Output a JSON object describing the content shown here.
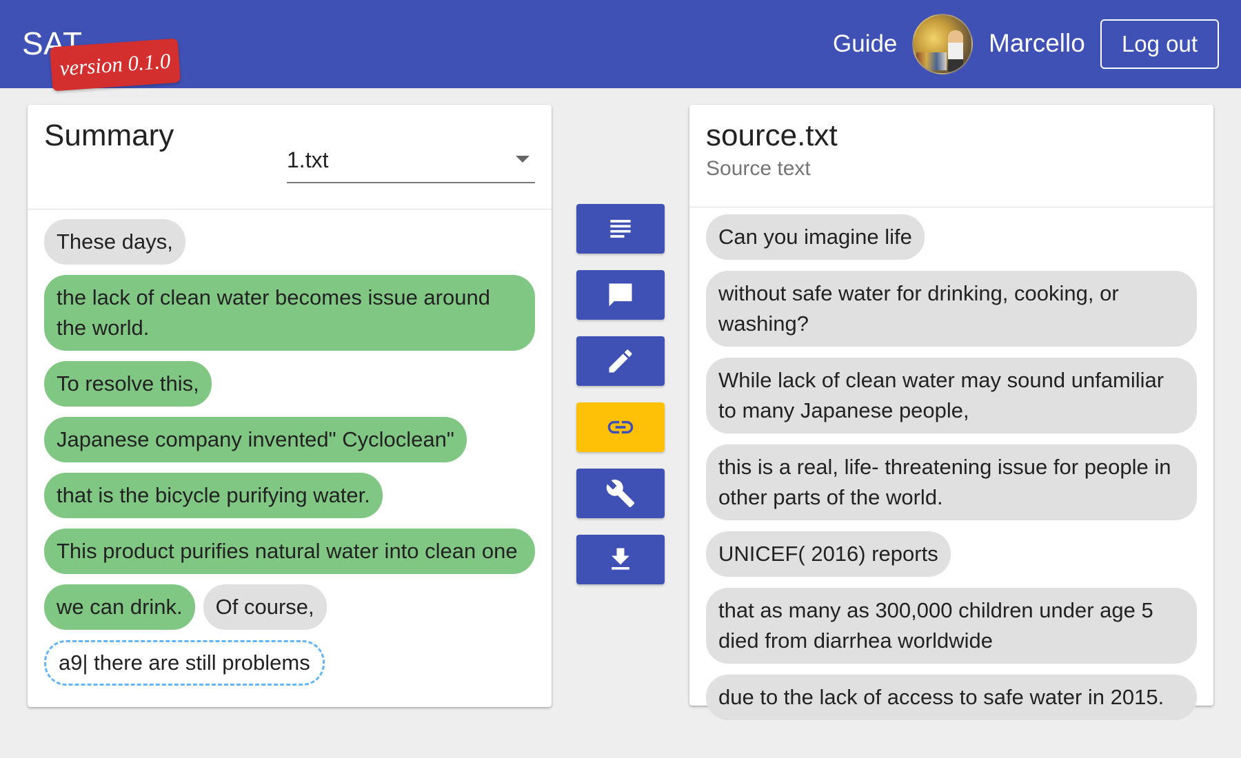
{
  "header": {
    "brand": "SAT",
    "version": "version 0.1.0",
    "guide_label": "Guide",
    "user_name": "Marcello",
    "logout_label": "Log out",
    "bar_color": "#3f51b5",
    "badge_color": "#d32f2f"
  },
  "summary_panel": {
    "title": "Summary",
    "selected_file": "1.txt",
    "chips": [
      {
        "text": "These days,",
        "state": "grey"
      },
      {
        "text": "the lack of clean water becomes issue around the world.",
        "state": "green"
      },
      {
        "text": "To resolve this,",
        "state": "green"
      },
      {
        "text": "Japanese company invented\" Cycloclean\"",
        "state": "green"
      },
      {
        "text": "that is the bicycle purifying water.",
        "state": "green"
      },
      {
        "text": "This product purifies natural water into clean one",
        "state": "green"
      },
      {
        "text": "we can drink.",
        "state": "green"
      },
      {
        "text": "Of course,",
        "state": "grey"
      },
      {
        "text": "a9| there are still problems",
        "state": "editing"
      }
    ]
  },
  "source_panel": {
    "title": "source.txt",
    "subtitle": "Source text",
    "chips": [
      {
        "text": "Can you imagine life",
        "state": "grey"
      },
      {
        "text": "without safe water for drinking, cooking, or washing?",
        "state": "grey"
      },
      {
        "text": "While lack of clean water may sound unfamiliar to many Japanese people,",
        "state": "grey"
      },
      {
        "text": "this is a real, life- threatening issue for people in other parts of the world.",
        "state": "grey"
      },
      {
        "text": "UNICEF( 2016) reports",
        "state": "grey"
      },
      {
        "text": "that as many as 300,000 children under age 5 died from diarrhea worldwide",
        "state": "grey"
      },
      {
        "text": "due to the lack of access to safe water in 2015.",
        "state": "grey"
      }
    ]
  },
  "toolbar": {
    "buttons": [
      {
        "icon": "text-lines-icon",
        "active": false
      },
      {
        "icon": "comment-icon",
        "active": false
      },
      {
        "icon": "pencil-icon",
        "active": false
      },
      {
        "icon": "link-icon",
        "active": true
      },
      {
        "icon": "wrench-icon",
        "active": false
      },
      {
        "icon": "download-icon",
        "active": false
      }
    ],
    "active_color": "#ffc107",
    "default_color": "#3f51b5"
  },
  "chip_colors": {
    "grey": "#e0e0e0",
    "green": "#81c784",
    "editing_border": "#64b5f6"
  }
}
